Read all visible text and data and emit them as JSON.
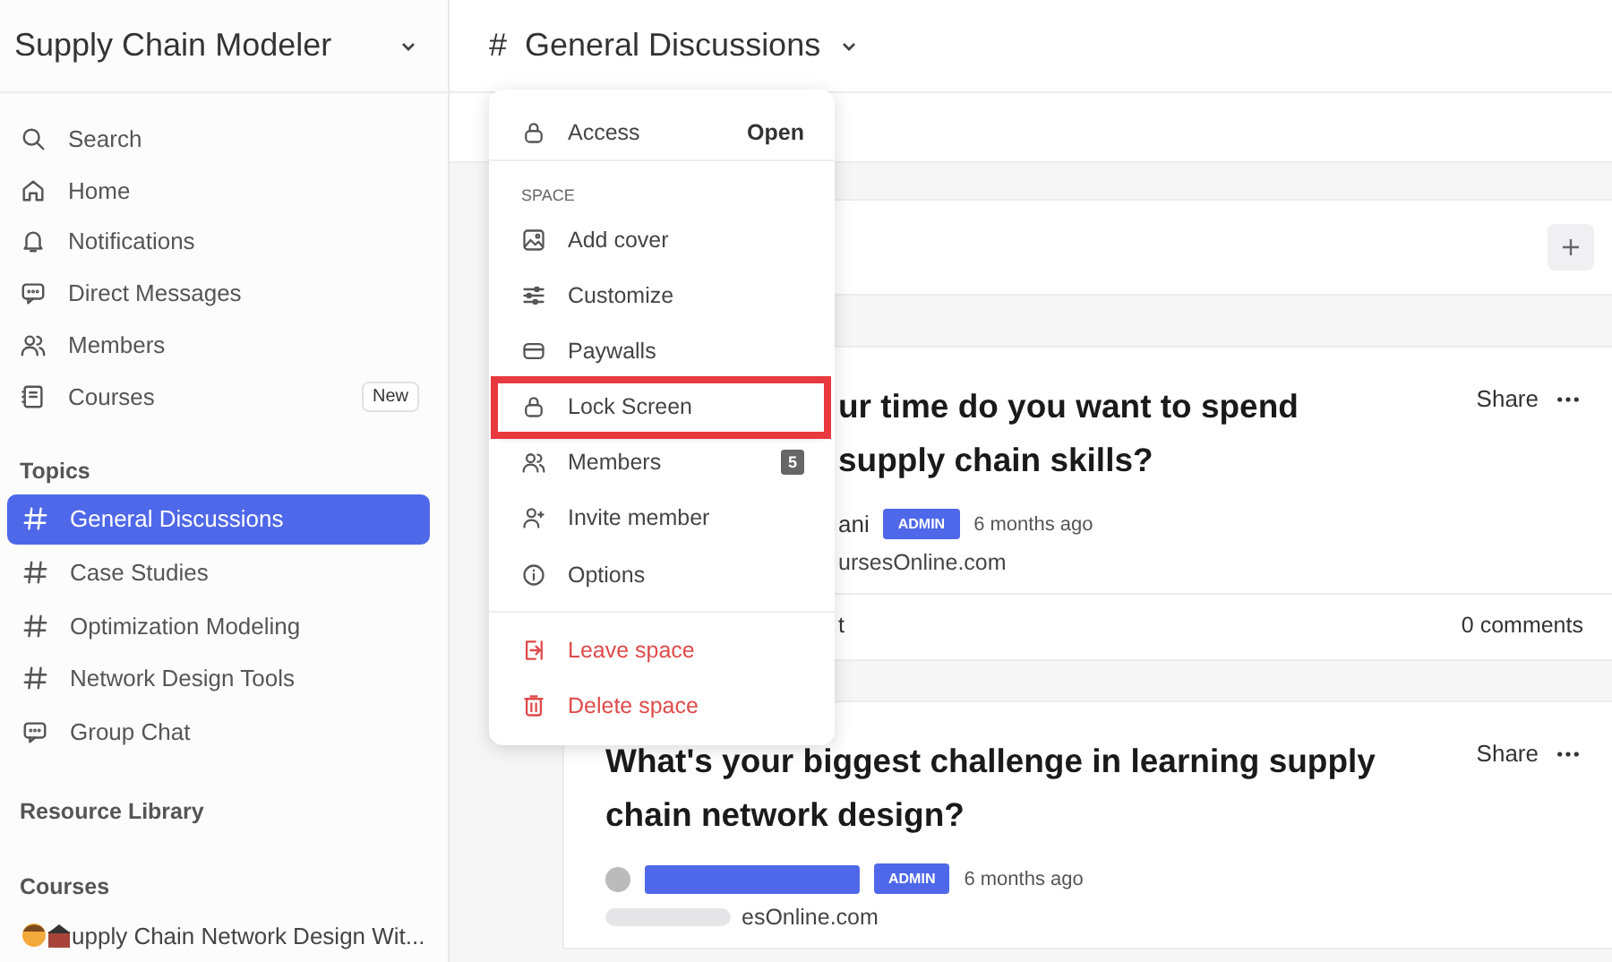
{
  "sidebar": {
    "title": "Supply Chain Modeler",
    "nav": [
      {
        "kind": "search",
        "label": "Search"
      },
      {
        "kind": "home",
        "label": "Home"
      },
      {
        "kind": "bell",
        "label": "Notifications"
      },
      {
        "kind": "chat",
        "label": "Direct Messages"
      },
      {
        "kind": "people",
        "label": "Members"
      },
      {
        "kind": "book",
        "label": "Courses",
        "badge": "New"
      }
    ],
    "topics_heading": "Topics",
    "topics": [
      {
        "kind": "hash",
        "label": "General Discussions",
        "selected": true
      },
      {
        "kind": "hash",
        "label": "Case Studies",
        "selected": false
      },
      {
        "kind": "hash",
        "label": "Optimization Modeling",
        "selected": false
      },
      {
        "kind": "hash",
        "label": "Network Design Tools",
        "selected": false
      },
      {
        "kind": "chat",
        "label": "Group Chat",
        "selected": false
      }
    ],
    "resource_heading": "Resource Library",
    "courses_heading": "Courses",
    "course_item": "upply Chain Network Design Wit..."
  },
  "header": {
    "hash": "#",
    "title": "General Discussions"
  },
  "menu": {
    "access_label": "Access",
    "access_value": "Open",
    "section": "SPACE",
    "items": [
      {
        "kind": "image",
        "label": "Add cover",
        "highlighted": false
      },
      {
        "kind": "sliders",
        "label": "Customize",
        "highlighted": false
      },
      {
        "kind": "card",
        "label": "Paywalls",
        "highlighted": false
      },
      {
        "kind": "lock",
        "label": "Lock Screen",
        "highlighted": true
      },
      {
        "kind": "people",
        "label": "Members",
        "count": "5",
        "highlighted": false
      },
      {
        "kind": "person-add",
        "label": "Invite member",
        "highlighted": false
      },
      {
        "kind": "info",
        "label": "Options",
        "highlighted": false
      }
    ],
    "danger_items": [
      {
        "kind": "exit",
        "label": "Leave space"
      },
      {
        "kind": "trash",
        "label": "Delete space"
      }
    ]
  },
  "posts": [
    {
      "title_lines": [
        "ur time do you want to spend",
        "supply chain skills?"
      ],
      "author": "ani",
      "role": "ADMIN",
      "time": "6 months ago",
      "subtitle": "ursesOnline.com",
      "footer_left": "t",
      "comments": "0 comments",
      "share": "Share",
      "redacted_author": false
    },
    {
      "title_lines": [
        "What's your biggest challenge in learning supply",
        "chain network design?"
      ],
      "role": "ADMIN",
      "time": "6 months ago",
      "subtitle": "esOnline.com",
      "share": "Share",
      "redacted_author": true
    }
  ]
}
